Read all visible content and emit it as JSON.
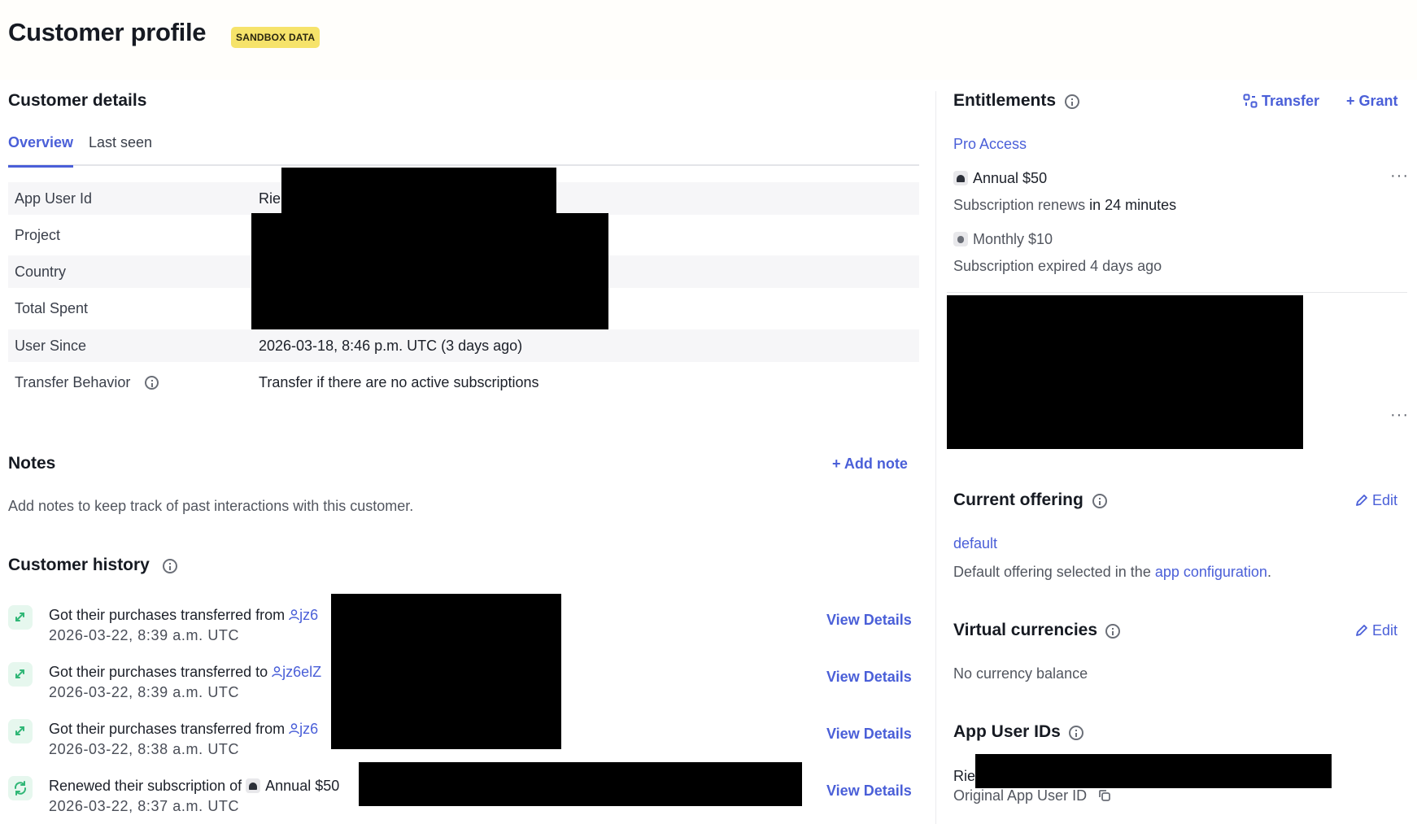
{
  "header": {
    "title": "Customer profile",
    "badge": "SANDBOX DATA"
  },
  "customer_details": {
    "title": "Customer details",
    "tabs": [
      {
        "label": "Overview",
        "active": true
      },
      {
        "label": "Last seen",
        "active": false
      }
    ],
    "rows": [
      {
        "label": "App User Id",
        "value": "Rie"
      },
      {
        "label": "Project",
        "value": ""
      },
      {
        "label": "Country",
        "value": ""
      },
      {
        "label": "Total Spent",
        "value": ""
      },
      {
        "label": "User Since",
        "value": "2026-03-18, 8:46 p.m. UTC (3 days ago)"
      },
      {
        "label": "Transfer Behavior",
        "value": "Transfer if there are no active subscriptions"
      }
    ]
  },
  "notes": {
    "title": "Notes",
    "add_label": "+ Add note",
    "empty_text": "Add notes to keep track of past interactions with this customer."
  },
  "history": {
    "title": "Customer history",
    "view_label": "View Details",
    "items": [
      {
        "text": "Got their purchases transferred from",
        "user": "jz6",
        "date": "2026-03-22, 8:39 a.m. UTC",
        "type": "transfer"
      },
      {
        "text": "Got their purchases transferred to",
        "user": "jz6elZ",
        "date": "2026-03-22, 8:39 a.m. UTC",
        "type": "transfer"
      },
      {
        "text": "Got their purchases transferred from",
        "user": "jz6",
        "date": "2026-03-22, 8:38 a.m. UTC",
        "type": "transfer"
      },
      {
        "text": "Renewed their subscription of",
        "product": "Annual $50",
        "date": "2026-03-22, 8:37 a.m. UTC",
        "type": "renewal"
      }
    ]
  },
  "entitlements": {
    "title": "Entitlements",
    "transfer_label": "Transfer",
    "grant_label": "+ Grant",
    "name": "Pro Access",
    "subscriptions": [
      {
        "product": "Annual $50",
        "platform": "android",
        "status_prefix": "Subscription renews",
        "status_emph": "in 24 minutes"
      },
      {
        "product": "Monthly $10",
        "platform": "apple",
        "status_prefix": "Subscription expired 4 days ago",
        "status_emph": ""
      }
    ]
  },
  "current_offering": {
    "title": "Current offering",
    "edit_label": "Edit",
    "offering": "default",
    "desc_prefix": "Default offering selected in the",
    "desc_link": "app configuration",
    "desc_suffix": "."
  },
  "virtual_currencies": {
    "title": "Virtual currencies",
    "edit_label": "Edit",
    "empty": "No currency balance"
  },
  "app_user_ids": {
    "title": "App User IDs",
    "id_value": "Rie",
    "id_caption": "Original App User ID"
  }
}
